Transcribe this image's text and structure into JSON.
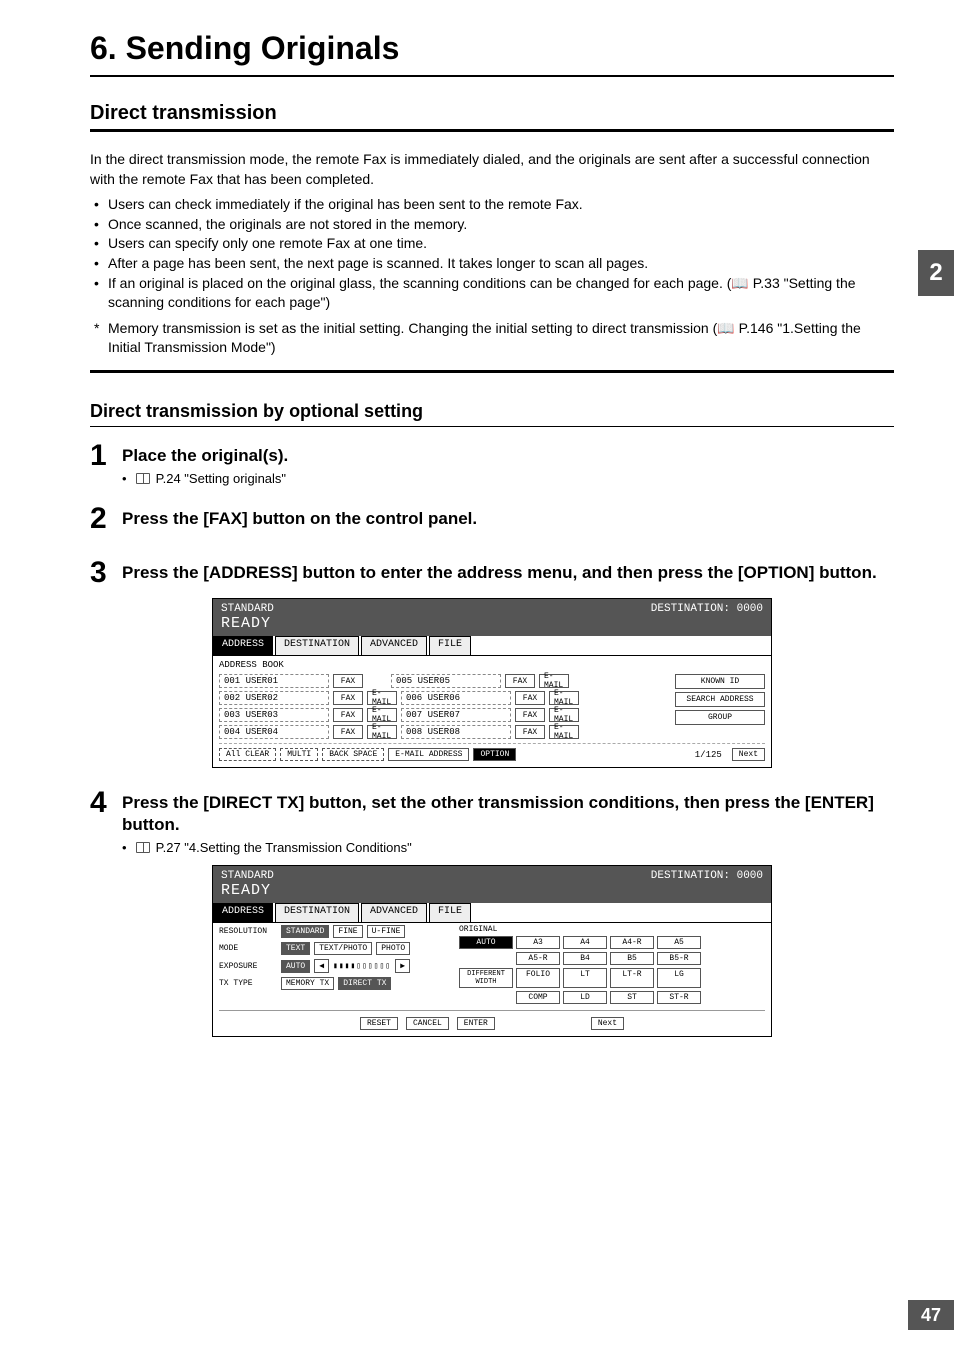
{
  "chapter": {
    "title": "6. Sending Originals"
  },
  "section": {
    "title": "Direct transmission"
  },
  "intro": "In the direct transmission mode, the remote Fax is immediately dialed, and the originals are sent after a successful connection with the remote Fax that has been completed.",
  "bullets": [
    "Users can check immediately if the original has been sent to the remote Fax.",
    "Once scanned, the originals are not stored in the memory.",
    "Users can specify only one remote Fax at one time.",
    "After a page has been sent, the next page is scanned. It takes longer to scan all pages.",
    "If an original is placed on the original glass, the scanning conditions can be changed for each page. (📖 P.33 \"Setting the scanning conditions for each page\")"
  ],
  "starnote": "Memory transmission is set as the initial setting. Changing the initial setting to direct transmission (📖 P.146 \"1.Setting the Initial Transmission Mode\")",
  "subsection": {
    "title": "Direct transmission by optional setting"
  },
  "steps": {
    "1": {
      "title": "Place the original(s).",
      "note": "P.24 \"Setting originals\""
    },
    "2": {
      "title": "Press the [FAX] button on the control panel."
    },
    "3": {
      "title": "Press the [ADDRESS] button to enter the address menu, and then press the [OPTION] button."
    },
    "4": {
      "title": "Press the [DIRECT TX] button, set the other transmission conditions, then press the [ENTER] button.",
      "note": "P.27 \"4.Setting the Transmission Conditions\""
    }
  },
  "screen1": {
    "status": "STANDARD",
    "ready": "READY",
    "dest": "DESTINATION: 0000",
    "tabs": [
      "ADDRESS",
      "DESTINATION",
      "ADVANCED",
      "FILE"
    ],
    "label": "ADDRESS BOOK",
    "rows_left": [
      "001 USER01",
      "002 USER02",
      "003 USER03",
      "004 USER04"
    ],
    "rows_right": [
      "005 USER05",
      "006 USER06",
      "007 USER07",
      "008 USER08"
    ],
    "tiny": {
      "fax": "FAX",
      "email": "E-MAIL"
    },
    "side": [
      "KNOWN ID",
      "SEARCH ADDRESS",
      "GROUP"
    ],
    "bottom": [
      "All CLEAR",
      "MULTI",
      "BACK SPACE",
      "E-MAIL ADDRESS",
      "OPTION"
    ],
    "page": "1/125",
    "next": "Next"
  },
  "screen2": {
    "status": "STANDARD",
    "ready": "READY",
    "dest": "DESTINATION: 0000",
    "tabs": [
      "ADDRESS",
      "DESTINATION",
      "ADVANCED",
      "FILE"
    ],
    "left": {
      "resolution": {
        "label": "RESOLUTION",
        "opts": [
          "STANDARD",
          "FINE",
          "U-FINE"
        ]
      },
      "mode": {
        "label": "MODE",
        "opts": [
          "TEXT",
          "TEXT/PHOTO",
          "PHOTO"
        ]
      },
      "exposure": {
        "label": "EXPOSURE",
        "auto": "AUTO"
      },
      "txtype": {
        "label": "TX TYPE",
        "opts": [
          "MEMORY TX",
          "DIRECT TX"
        ]
      }
    },
    "right": {
      "label": "ORIGINAL",
      "auto": "AUTO",
      "diff": "DIFFERENT WIDTH",
      "sizes": [
        "A3",
        "A4",
        "A4-R",
        "A5",
        "A5-R",
        "B4",
        "B5",
        "B5-R",
        "FOLIO",
        "LT",
        "LT-R",
        "LG",
        "COMP",
        "LD",
        "ST",
        "ST-R"
      ]
    },
    "footer": [
      "RESET",
      "CANCEL",
      "ENTER"
    ],
    "next": "Next"
  },
  "sidetab": "2",
  "pagenum": "47"
}
